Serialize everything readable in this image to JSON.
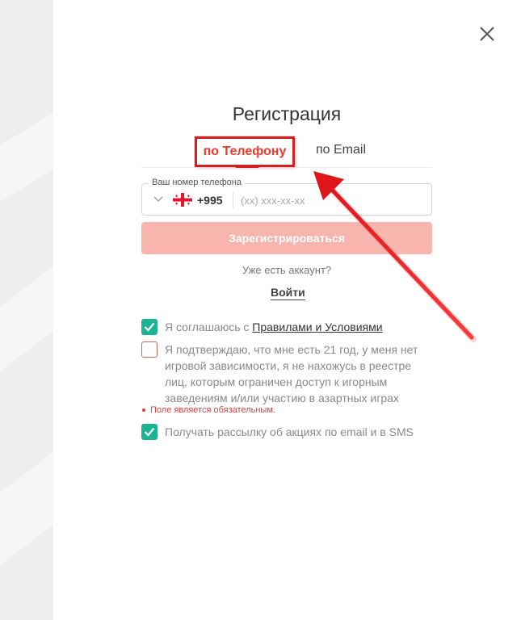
{
  "modal": {
    "title": "Регистрация"
  },
  "tabs": {
    "phone_label": "по Телефону",
    "email_label": "по Email"
  },
  "phone": {
    "label": "Ваш номер телефона",
    "country_code": "+995",
    "placeholder": "(xx) xxx-xx-xx",
    "value": ""
  },
  "register_button": "Зарегистрироваться",
  "have_account": "Уже есть аккаунт?",
  "login_link": "Войти",
  "agreements": {
    "terms_prefix": "Я соглашаюсь с ",
    "terms_link": "Правилами и Условиями",
    "terms_checked": true,
    "age_line1": "Я подтверждаю, что мне есть 21 год, у меня нет",
    "age_line2": "игровой зависимости, я не нахожусь в реестре",
    "age_line3": "лиц, которым ограничен доступ к игорным",
    "age_line4": "заведениям и/или участию в азартных играх",
    "age_checked": false,
    "error_text": "Поле является обязательным.",
    "newsletter_label": "Получать рассылку об акциях по email и в SMS",
    "newsletter_checked": true
  },
  "colors": {
    "accent_red": "#ec3a2d",
    "button_disabled": "#f8b5ae",
    "checkbox_green": "#1ab394",
    "error_red": "#e03c3c"
  },
  "icons": {
    "close": "close-icon",
    "chevron": "chevron-down-icon",
    "flag": "georgia-flag-icon",
    "check": "check-icon",
    "annotation": "red-arrow-annotation"
  }
}
